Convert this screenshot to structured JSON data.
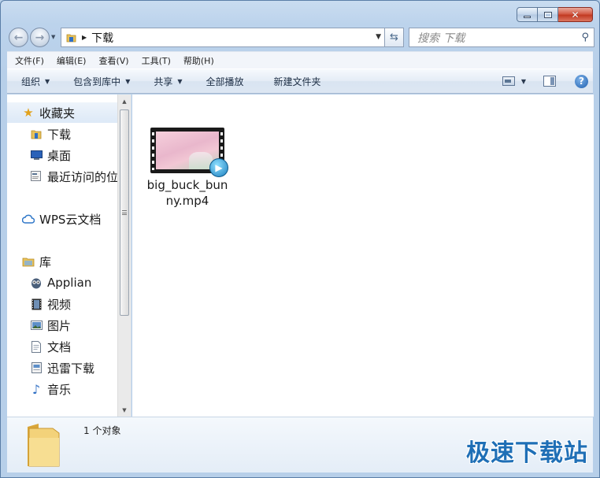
{
  "window": {
    "address": {
      "path": "下载"
    },
    "search": {
      "placeholder": "搜索 下载"
    }
  },
  "menu": [
    "文件(F)",
    "编辑(E)",
    "查看(V)",
    "工具(T)",
    "帮助(H)"
  ],
  "toolbar": {
    "organize": "组织",
    "include_in_library": "包含到库中",
    "share": "共享",
    "play_all": "全部播放",
    "new_folder": "新建文件夹"
  },
  "navigation": {
    "favorites": {
      "label": "收藏夹",
      "items": [
        "下载",
        "桌面",
        "最近访问的位置"
      ]
    },
    "wps": {
      "label": "WPS云文档"
    },
    "libraries": {
      "label": "库",
      "items": [
        "Applian",
        "视频",
        "图片",
        "文档",
        "迅雷下载",
        "音乐"
      ]
    }
  },
  "files": [
    {
      "name": "big_buck_bunny.mp4",
      "icon": "video-file-icon"
    }
  ],
  "status": {
    "count": "1 个对象"
  },
  "watermark": "极速下载站",
  "colors": {
    "accent": "#1f6fb6",
    "selection": "#dde9f7"
  }
}
